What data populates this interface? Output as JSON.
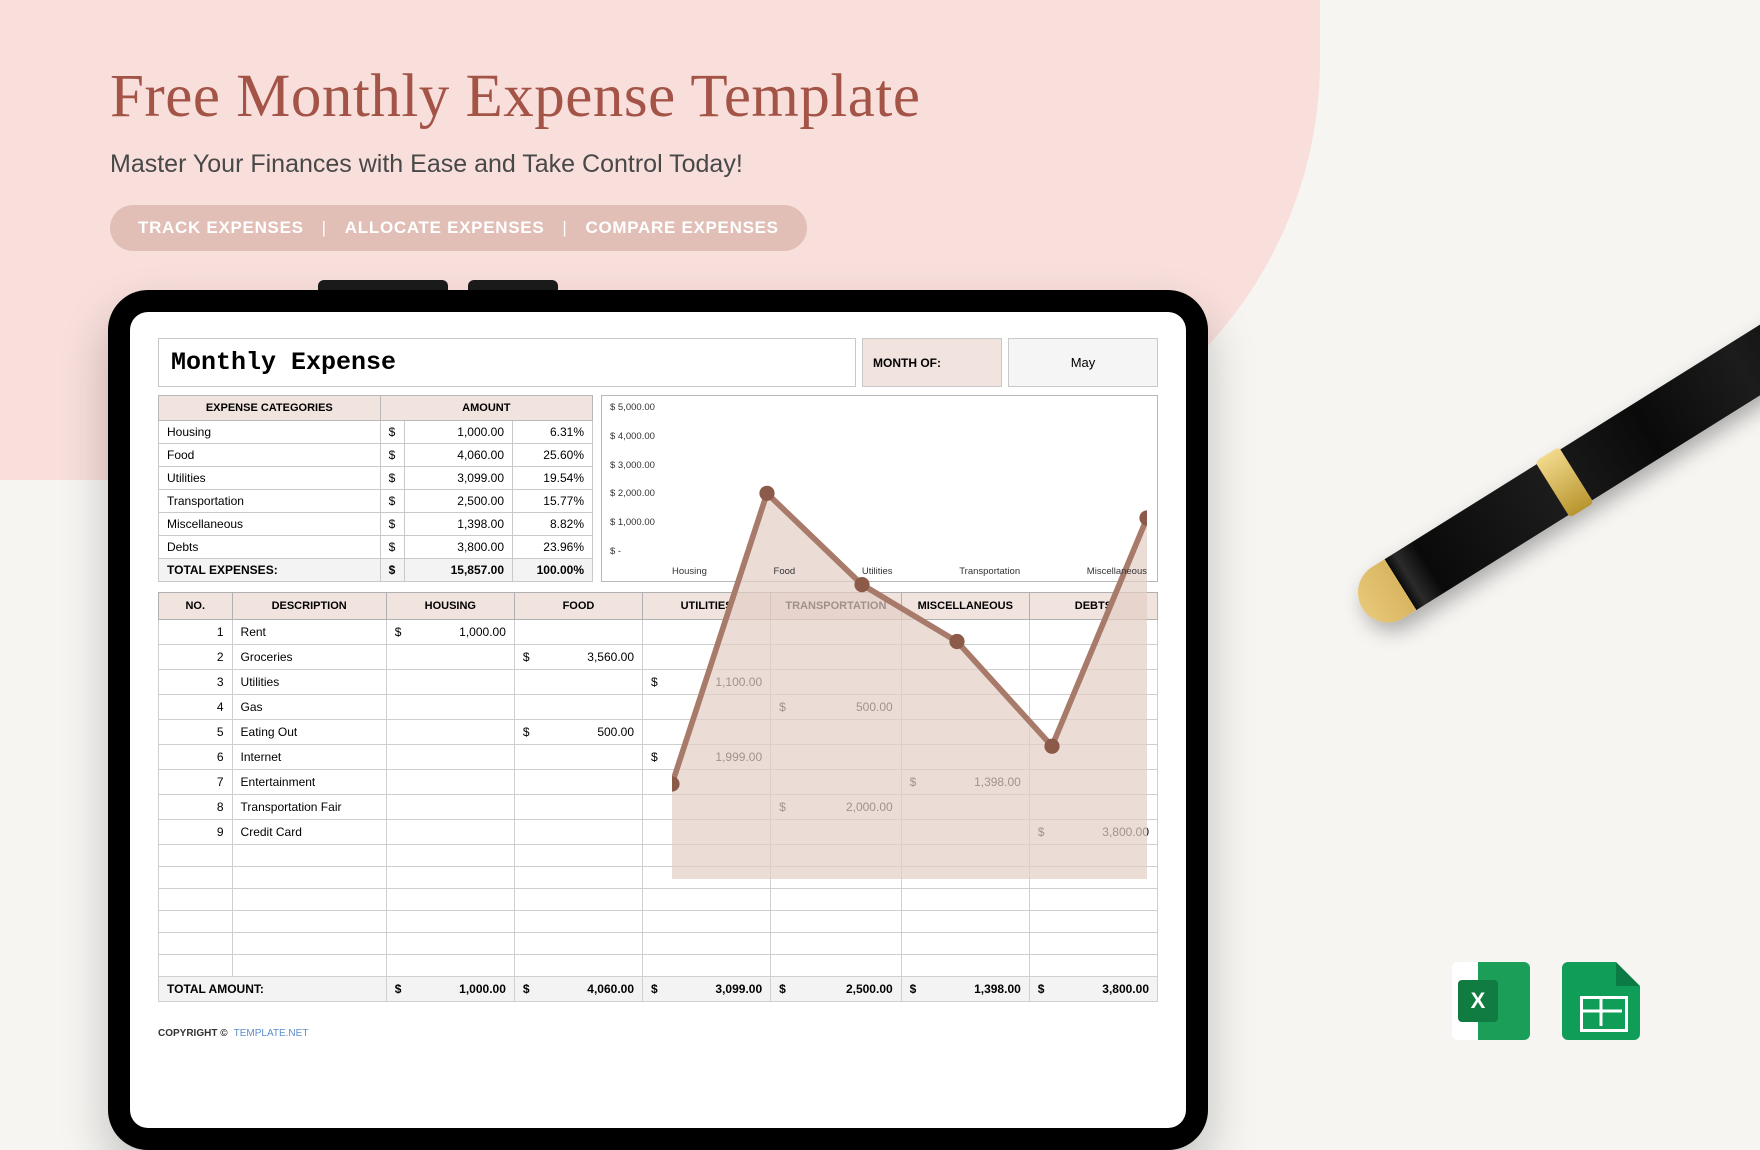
{
  "header": {
    "title": "Free Monthly Expense Template",
    "subtitle": "Master Your Finances with Ease and Take Control Today!",
    "tags": [
      "TRACK EXPENSES",
      "ALLOCATE EXPENSES",
      "COMPARE EXPENSES"
    ]
  },
  "sheet": {
    "title": "Monthly Expense",
    "month_label": "MONTH OF:",
    "month_value": "May",
    "cat_headers": {
      "cat": "EXPENSE CATEGORIES",
      "amt": "AMOUNT"
    },
    "categories": [
      {
        "name": "Housing",
        "amount": "1,000.00",
        "pct": "6.31%"
      },
      {
        "name": "Food",
        "amount": "4,060.00",
        "pct": "25.60%"
      },
      {
        "name": "Utilities",
        "amount": "3,099.00",
        "pct": "19.54%"
      },
      {
        "name": "Transportation",
        "amount": "2,500.00",
        "pct": "15.77%"
      },
      {
        "name": "Miscellaneous",
        "amount": "1,398.00",
        "pct": "8.82%"
      },
      {
        "name": "Debts",
        "amount": "3,800.00",
        "pct": "23.96%"
      }
    ],
    "cat_total": {
      "label": "TOTAL EXPENSES:",
      "amount": "15,857.00",
      "pct": "100.00%"
    },
    "detail_headers": [
      "NO.",
      "DESCRIPTION",
      "HOUSING",
      "FOOD",
      "UTILITIES",
      "TRANSPORTATION",
      "MISCELLANEOUS",
      "DEBTS"
    ],
    "rows": [
      {
        "no": "1",
        "desc": "Rent",
        "housing": "1,000.00",
        "food": "",
        "util": "",
        "trans": "",
        "misc": "",
        "debts": ""
      },
      {
        "no": "2",
        "desc": "Groceries",
        "housing": "",
        "food": "3,560.00",
        "util": "",
        "trans": "",
        "misc": "",
        "debts": ""
      },
      {
        "no": "3",
        "desc": "Utilities",
        "housing": "",
        "food": "",
        "util": "1,100.00",
        "trans": "",
        "misc": "",
        "debts": ""
      },
      {
        "no": "4",
        "desc": "Gas",
        "housing": "",
        "food": "",
        "util": "",
        "trans": "500.00",
        "misc": "",
        "debts": ""
      },
      {
        "no": "5",
        "desc": "Eating Out",
        "housing": "",
        "food": "500.00",
        "util": "",
        "trans": "",
        "misc": "",
        "debts": ""
      },
      {
        "no": "6",
        "desc": "Internet",
        "housing": "",
        "food": "",
        "util": "1,999.00",
        "trans": "",
        "misc": "",
        "debts": ""
      },
      {
        "no": "7",
        "desc": "Entertainment",
        "housing": "",
        "food": "",
        "util": "",
        "trans": "",
        "misc": "1,398.00",
        "debts": ""
      },
      {
        "no": "8",
        "desc": "Transportation Fair",
        "housing": "",
        "food": "",
        "util": "",
        "trans": "2,000.00",
        "misc": "",
        "debts": ""
      },
      {
        "no": "9",
        "desc": "Credit Card",
        "housing": "",
        "food": "",
        "util": "",
        "trans": "",
        "misc": "",
        "debts": "3,800.00"
      }
    ],
    "blank_rows": 6,
    "row_total": {
      "label": "TOTAL AMOUNT:",
      "housing": "1,000.00",
      "food": "4,060.00",
      "util": "3,099.00",
      "trans": "2,500.00",
      "misc": "1,398.00",
      "debts": "3,800.00"
    },
    "copyright": {
      "label": "COPYRIGHT  ©",
      "site": "TEMPLATE.NET"
    }
  },
  "chart_data": {
    "type": "area",
    "title": "",
    "xlabel": "",
    "ylabel": "",
    "ylim": [
      0,
      5000
    ],
    "yticks": [
      "$ 5,000.00",
      "$ 4,000.00",
      "$ 3,000.00",
      "$ 2,000.00",
      "$ 1,000.00",
      "$ -"
    ],
    "categories": [
      "Housing",
      "Food",
      "Utilities",
      "Transportation",
      "Miscellaneous",
      "Debts"
    ],
    "xlabels_shown": [
      "Housing",
      "Food",
      "Utilities",
      "Transportation",
      "Miscellaneous"
    ],
    "values": [
      1000,
      4060,
      3099,
      2500,
      1398,
      3800
    ],
    "color": "#e2cdc4"
  },
  "currency": "$"
}
